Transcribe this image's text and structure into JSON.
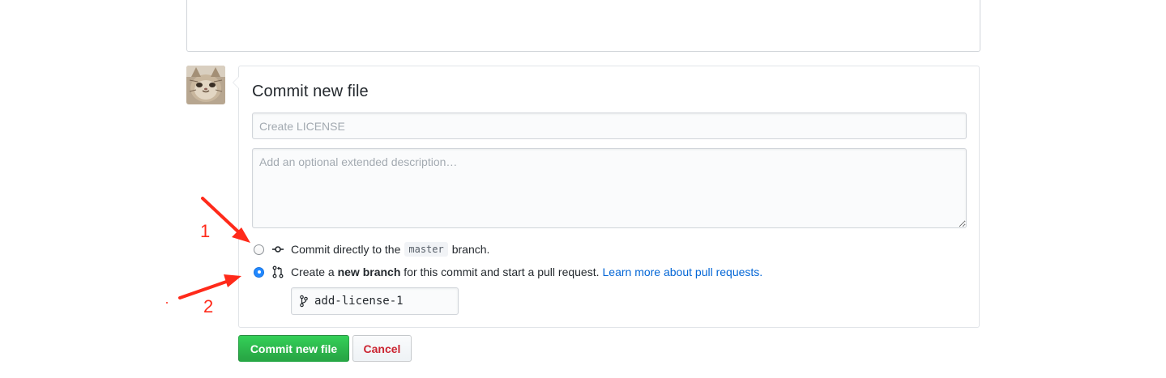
{
  "commit_form": {
    "title": "Commit new file",
    "summary_placeholder": "Create LICENSE",
    "description_placeholder": "Add an optional extended description…"
  },
  "options": {
    "direct": {
      "text_before": "Commit directly to the",
      "branch": "master",
      "text_after": "branch.",
      "checked": false
    },
    "new_branch": {
      "text_before": "Create a",
      "bold": "new branch",
      "text_after": "for this commit and start a pull request.",
      "link": "Learn more about pull requests.",
      "checked": true
    },
    "branch_name_value": "add-license-1"
  },
  "buttons": {
    "commit_label": "Commit new file",
    "cancel_label": "Cancel"
  },
  "annotations": {
    "label_1": "1",
    "label_2": "2",
    "color": "#ff2a1a"
  },
  "colors": {
    "primary_green": "#28a745",
    "link_blue": "#0366d6",
    "cancel_red": "#cb2431",
    "radio_blue": "#2188ff"
  },
  "icons": {
    "avatar": "cat-avatar",
    "commit_option": "git-commit-icon",
    "pr_option": "git-pull-request-icon",
    "branch_field": "git-branch-icon"
  }
}
